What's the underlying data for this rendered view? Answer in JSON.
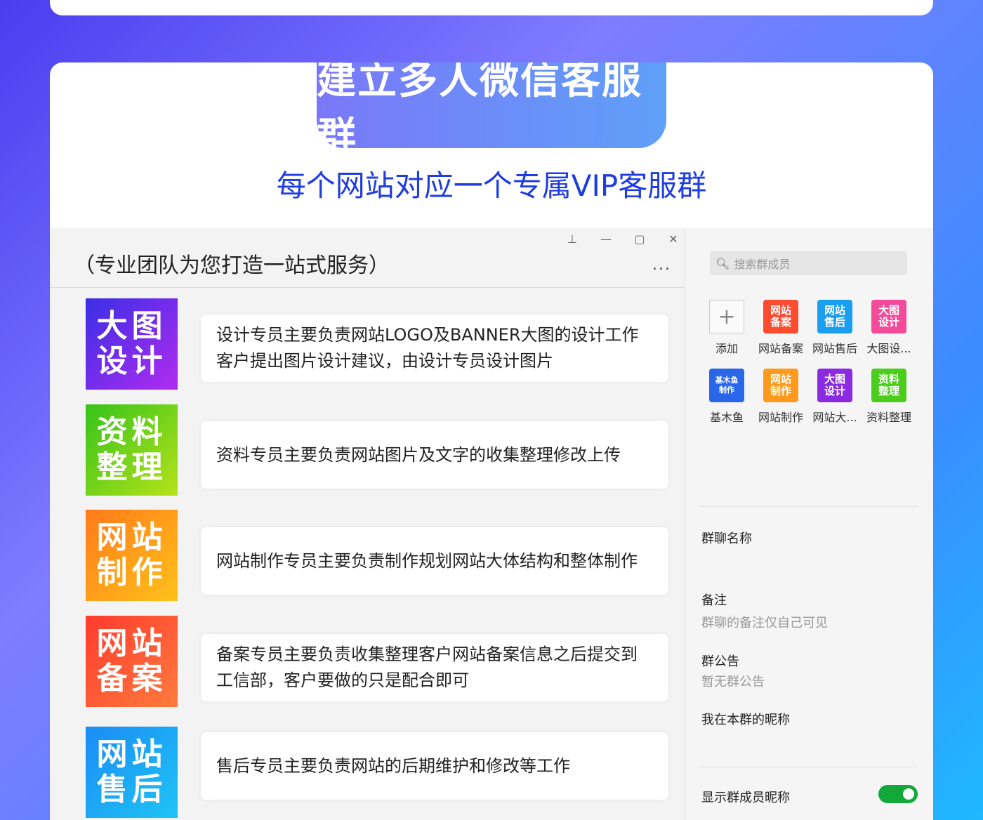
{
  "header": {
    "title": "建立多人微信客服群",
    "subtitle": "每个网站对应一个专属VIP客服群"
  },
  "chat": {
    "title": "（专业团队为您打造一站式服务）",
    "window_controls": [
      "pin-icon",
      "minimize-icon",
      "maximize-icon",
      "close-icon"
    ],
    "more": "...",
    "messages": [
      {
        "badge": [
          "大图",
          "设计"
        ],
        "color_from": "#3a2ee6",
        "color_to": "#b12cf0",
        "lines": [
          "设计专员主要负责网站LOGO及BANNER大图的设计工作",
          "客户提出图片设计建议，由设计专员设计图片"
        ]
      },
      {
        "badge": [
          "资料",
          "整理"
        ],
        "color_from": "#35c31a",
        "color_to": "#b7e21a",
        "lines": [
          "资料专员主要负责网站图片及文字的收集整理修改上传"
        ]
      },
      {
        "badge": [
          "网站",
          "制作"
        ],
        "color_from": "#ff7a1a",
        "color_to": "#ffc21a",
        "lines": [
          "网站制作专员主要负责制作规划网站大体结构和整体制作"
        ]
      },
      {
        "badge": [
          "网站",
          "备案"
        ],
        "color_from": "#ff3b2e",
        "color_to": "#ff7b3e",
        "lines": [
          "备案专员主要负责收集整理客户网站备案信息之后提交到",
          "工信部，客户要做的只是配合即可"
        ]
      },
      {
        "badge": [
          "网站",
          "售后"
        ],
        "color_from": "#1a8cf5",
        "color_to": "#1fc4f5",
        "lines": [
          "售后专员主要负责网站的后期维护和修改等工作"
        ]
      }
    ]
  },
  "sidebar": {
    "search_placeholder": "搜索群成员",
    "members": [
      {
        "type": "add",
        "name": "添加"
      },
      {
        "avatar": [
          "网站",
          "备案"
        ],
        "color": "#ff4b2e",
        "name": "网站备案"
      },
      {
        "avatar": [
          "网站",
          "售后"
        ],
        "color": "#1a9ff0",
        "name": "网站售后"
      },
      {
        "avatar": [
          "大图",
          "设计"
        ],
        "color": "#f44a9a",
        "name": "大图设..."
      },
      {
        "avatar": [
          "基木鱼",
          "制作"
        ],
        "color": "#2a66e8",
        "name": "基木鱼",
        "small": true
      },
      {
        "avatar": [
          "网站",
          "制作"
        ],
        "color": "#ff9a1e",
        "name": "网站制作"
      },
      {
        "avatar": [
          "大图",
          "设计"
        ],
        "color": "#8a2be2",
        "name": "网站大..."
      },
      {
        "avatar": [
          "资料",
          "整理"
        ],
        "color": "#4ccd1e",
        "name": "资料整理"
      }
    ],
    "group_name_label": "群聊名称",
    "remark_label": "备注",
    "remark_value": "群聊的备注仅自己可见",
    "notice_label": "群公告",
    "notice_value": "暂无群公告",
    "nickname_label": "我在本群的昵称",
    "show_nickname_label": "显示群成员昵称",
    "show_nickname_on": true,
    "toggle_color": "#13a83a"
  }
}
